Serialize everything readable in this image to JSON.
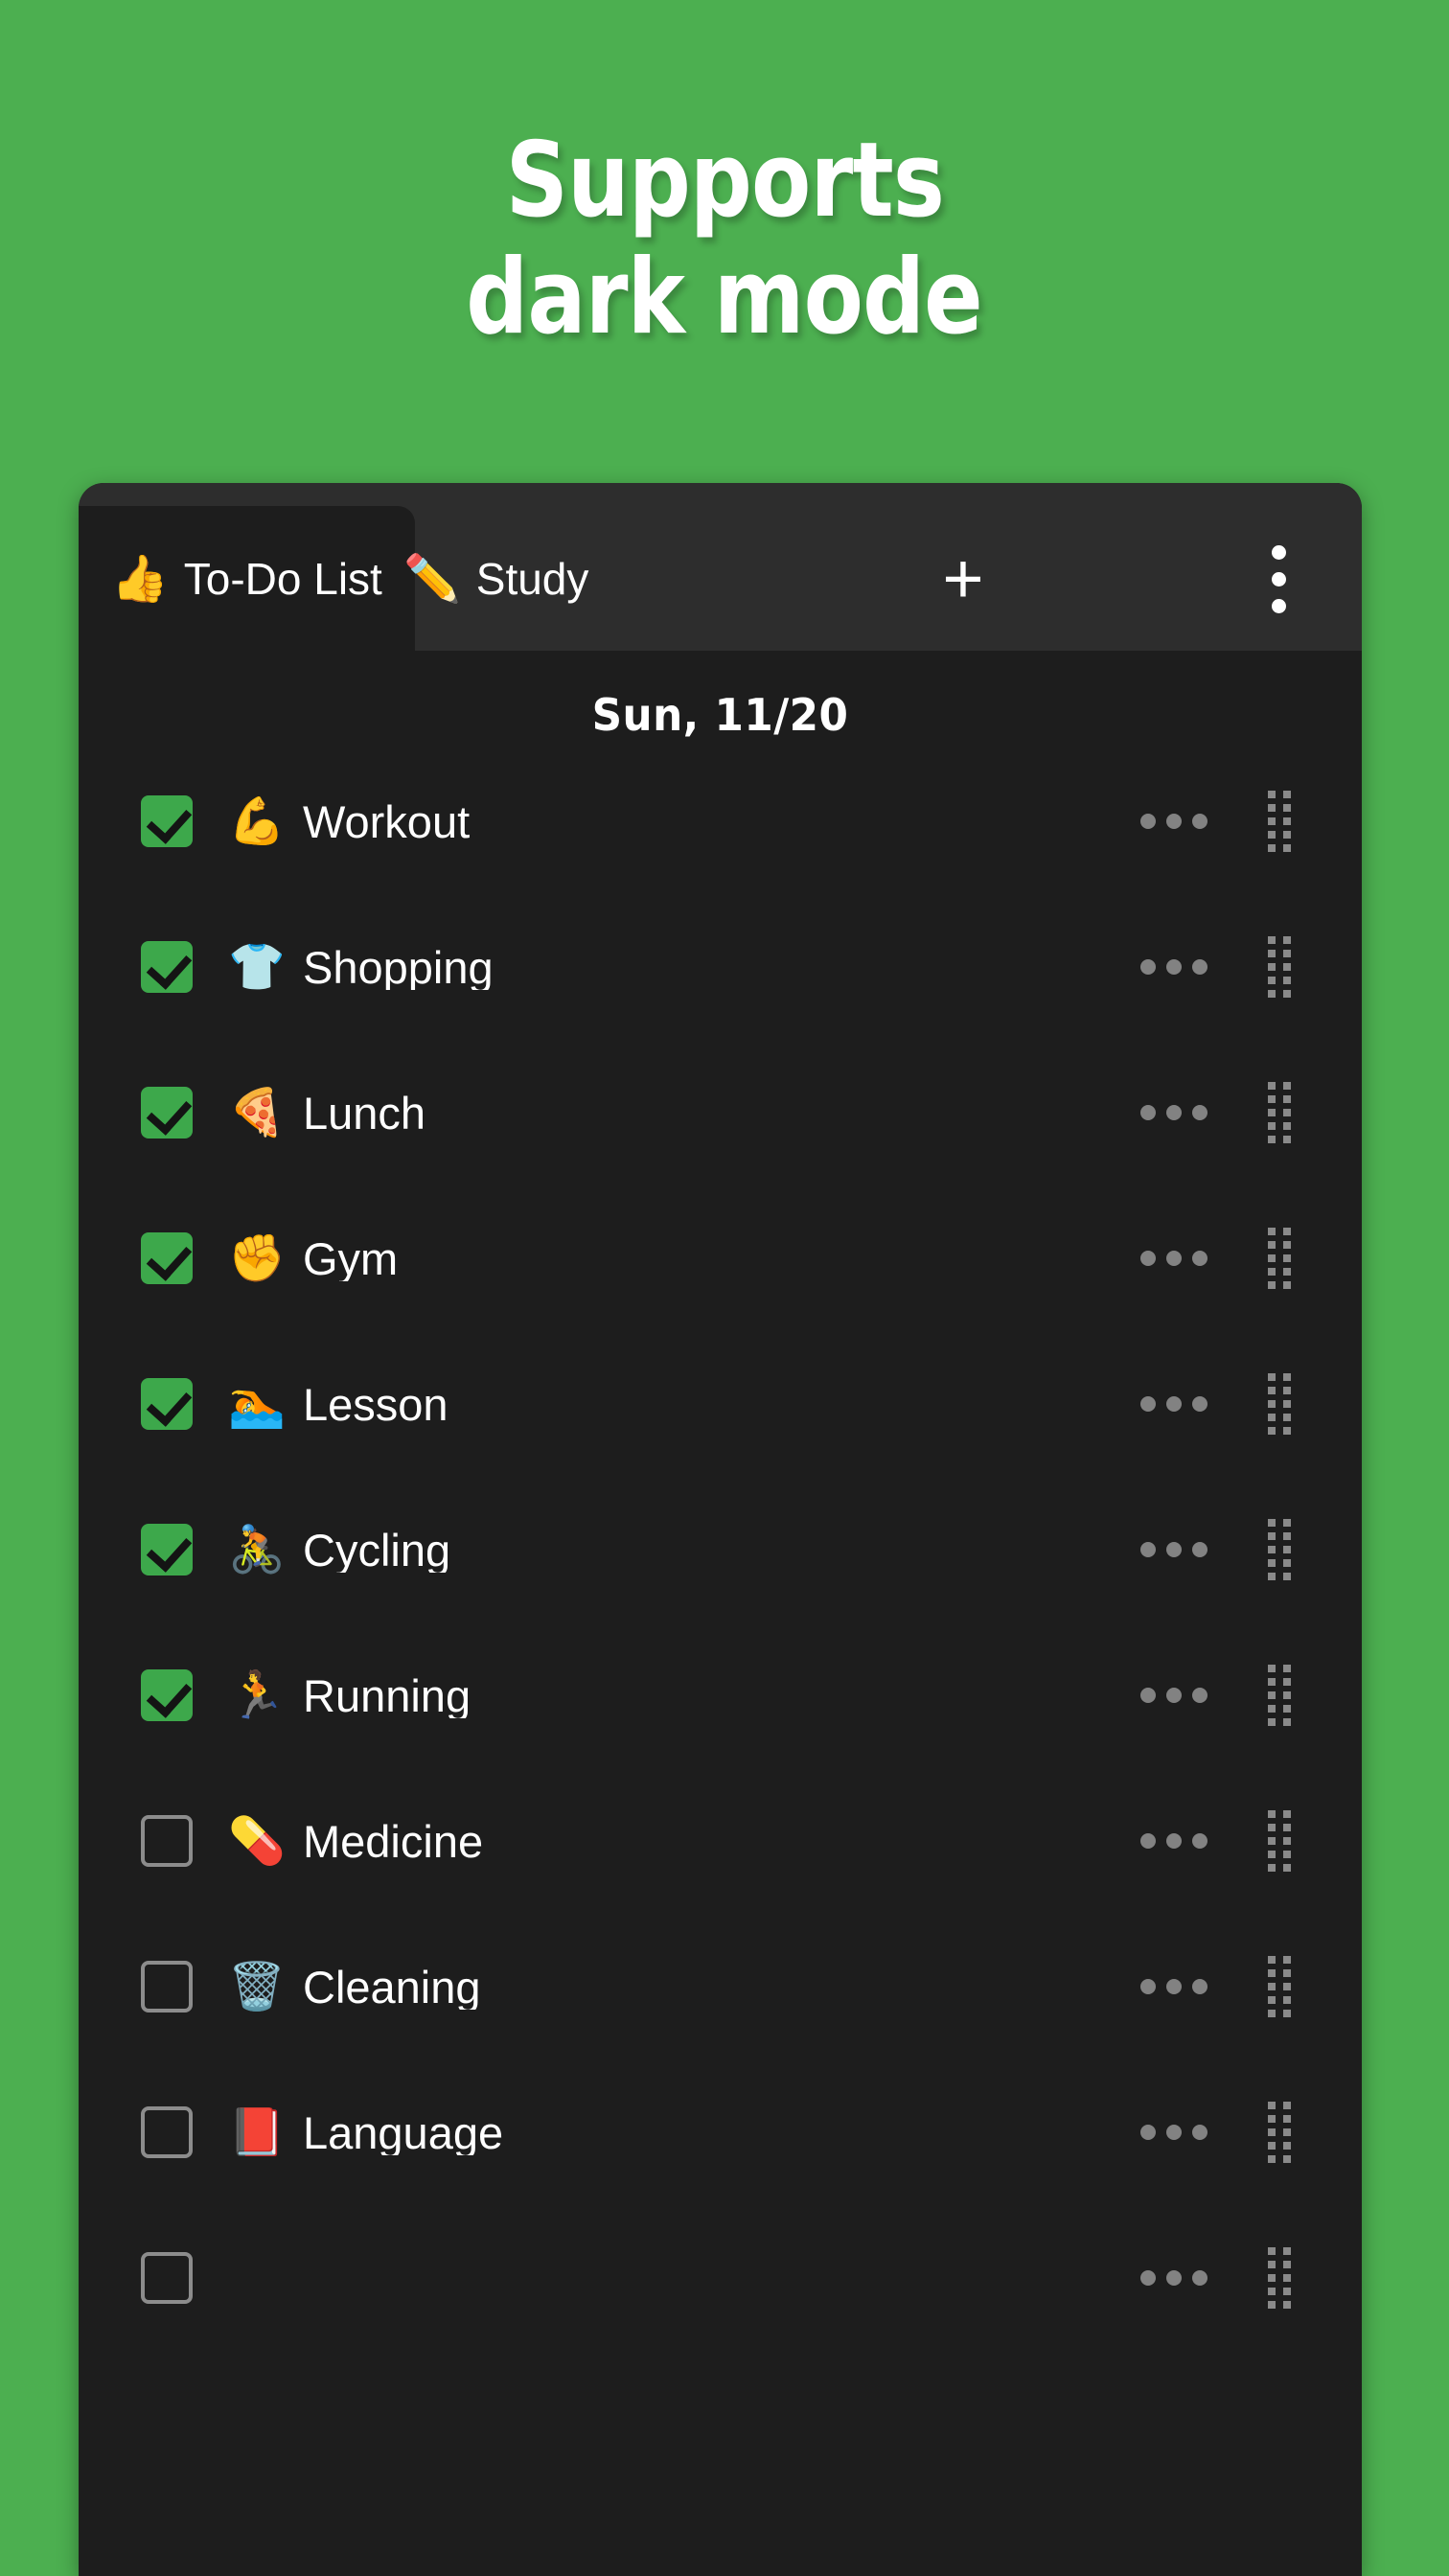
{
  "promo": {
    "line1": "Supports",
    "line2": "dark mode",
    "text_color": "#FFFFFF",
    "background_color": "#4CAF50"
  },
  "app": {
    "card_background": "#1D1D1D",
    "tabbar_background": "#2D2D2D",
    "accent_color": "#3DA84B",
    "tabs": [
      {
        "emoji": "👍",
        "label": "To-Do List",
        "active": true
      },
      {
        "emoji": "✏️",
        "label": "Study",
        "active": false
      }
    ],
    "add_tab_label": "+",
    "overflow_menu_label": "⋮",
    "date_header": "Sun, 11/20",
    "tasks": [
      {
        "emoji": "💪",
        "label": "Workout",
        "checked": true
      },
      {
        "emoji": "👕",
        "label": "Shopping",
        "checked": true
      },
      {
        "emoji": "🍕",
        "label": "Lunch",
        "checked": true
      },
      {
        "emoji": "✊",
        "label": "Gym",
        "checked": true
      },
      {
        "emoji": "🏊",
        "label": "Lesson",
        "checked": true
      },
      {
        "emoji": "🚴",
        "label": "Cycling",
        "checked": true
      },
      {
        "emoji": "🏃",
        "label": "Running",
        "checked": true
      },
      {
        "emoji": "💊",
        "label": "Medicine",
        "checked": false
      },
      {
        "emoji": "🗑️",
        "label": "Cleaning",
        "checked": false
      },
      {
        "emoji": "📕",
        "label": "Language",
        "checked": false
      },
      {
        "emoji": "",
        "label": "",
        "checked": false
      }
    ]
  }
}
